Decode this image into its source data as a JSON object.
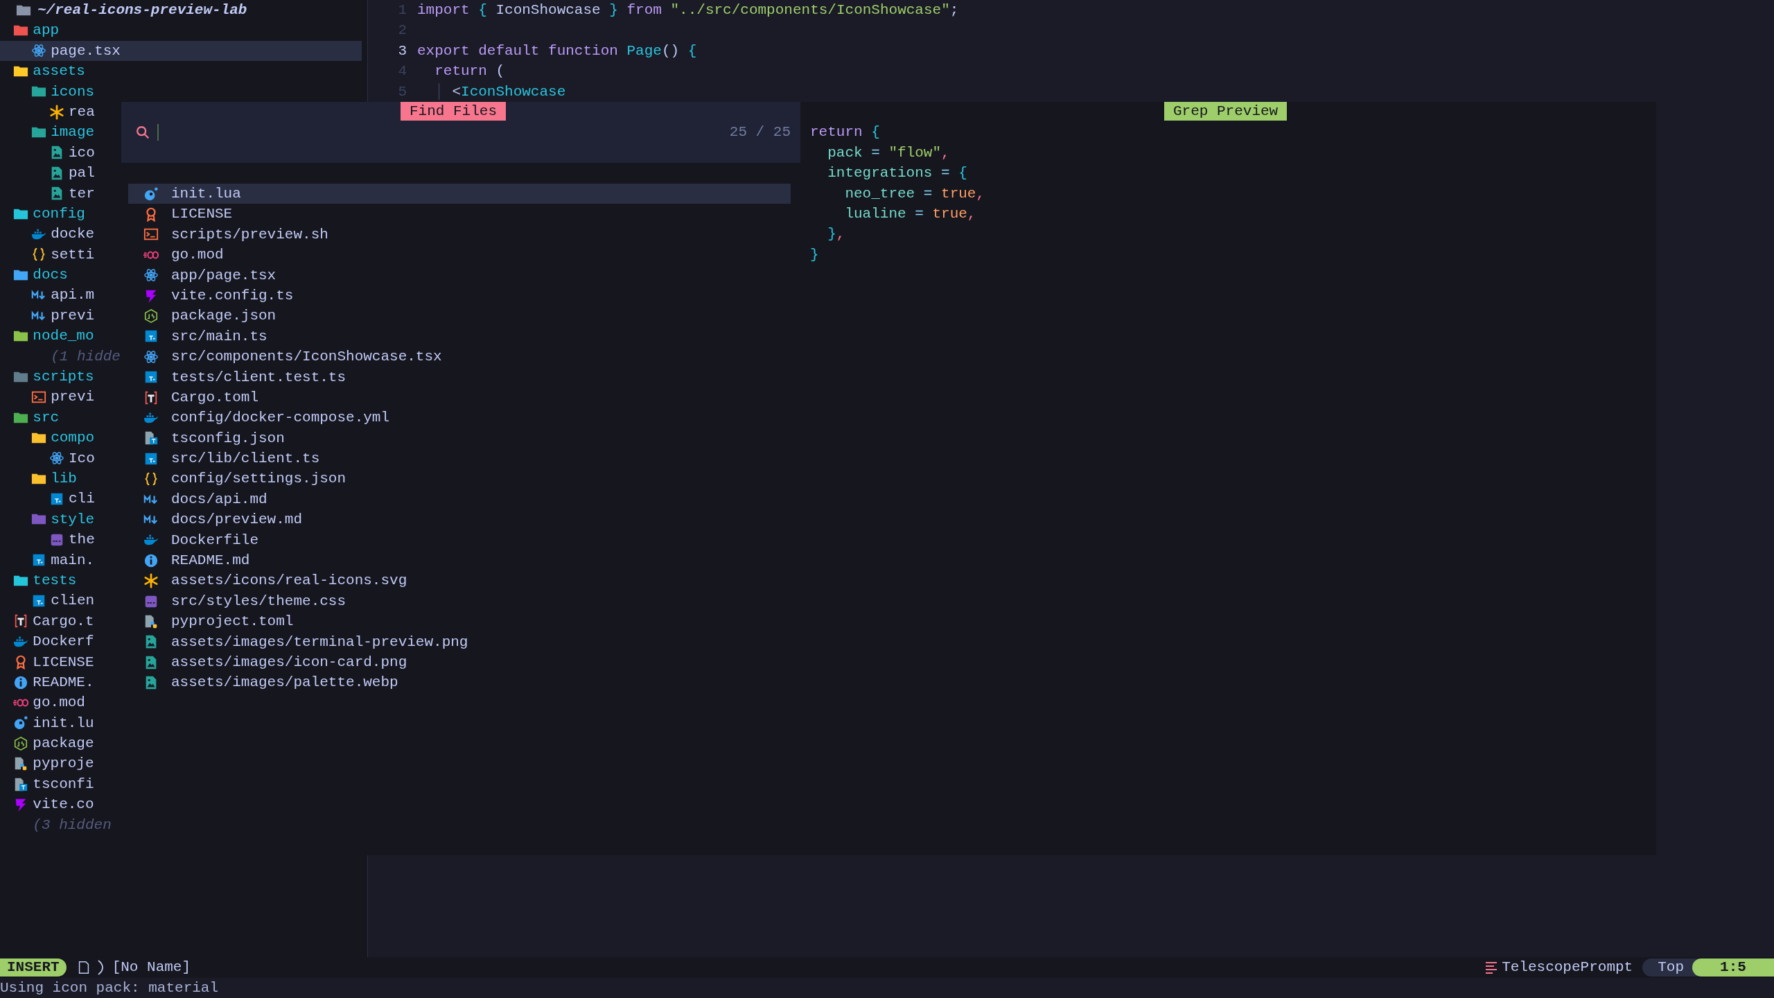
{
  "explorer": {
    "root": "~/real-icons-preview-lab",
    "items": [
      {
        "name": "app",
        "kind": "folder",
        "color": "#ef5350",
        "selected": false,
        "children": [
          {
            "name": "page.tsx",
            "kind": "react",
            "selected": true
          }
        ]
      },
      {
        "name": "assets",
        "kind": "folder",
        "color": "#ffca28",
        "selected": false,
        "children": [
          {
            "name": "icons",
            "kind": "folder",
            "color": "#26a69a",
            "selected": false,
            "children": [
              {
                "name": "rea",
                "kind": "svg",
                "selected": false
              }
            ]
          },
          {
            "name": "image",
            "kind": "folder",
            "color": "#26a69a",
            "selected": false,
            "children": [
              {
                "name": "ico",
                "kind": "image",
                "selected": false
              },
              {
                "name": "pal",
                "kind": "image",
                "selected": false
              },
              {
                "name": "ter",
                "kind": "image",
                "selected": false
              }
            ]
          }
        ]
      },
      {
        "name": "config",
        "kind": "folder",
        "color": "#26c6da",
        "selected": false,
        "children": [
          {
            "name": "docke",
            "kind": "docker",
            "selected": false
          },
          {
            "name": "setti",
            "kind": "json",
            "selected": false
          }
        ]
      },
      {
        "name": "docs",
        "kind": "folder",
        "color": "#42a5f5",
        "selected": false,
        "children": [
          {
            "name": "api.m",
            "kind": "markdown",
            "selected": false
          },
          {
            "name": "previ",
            "kind": "markdown",
            "selected": false
          }
        ]
      },
      {
        "name": "node_mo",
        "kind": "folder",
        "color": "#8bc34a",
        "selected": false,
        "children": [
          {
            "name": "(1 hidde",
            "kind": "hidden",
            "selected": false
          }
        ]
      },
      {
        "name": "scripts",
        "kind": "folder",
        "color": "#607d8b",
        "selected": false,
        "children": [
          {
            "name": "previ",
            "kind": "terminal",
            "selected": false
          }
        ]
      },
      {
        "name": "src",
        "kind": "folder",
        "color": "#4caf50",
        "selected": false,
        "children": [
          {
            "name": "compo",
            "kind": "folder",
            "color": "#fbc02d",
            "selected": false,
            "children": [
              {
                "name": "Ico",
                "kind": "react",
                "selected": false
              }
            ]
          },
          {
            "name": "lib",
            "kind": "folder",
            "color": "#fbc02d",
            "selected": false,
            "children": [
              {
                "name": "cli",
                "kind": "ts",
                "selected": false
              }
            ]
          },
          {
            "name": "style",
            "kind": "folder",
            "color": "#7e57c2",
            "selected": false,
            "children": [
              {
                "name": "the",
                "kind": "css",
                "selected": false
              }
            ]
          },
          {
            "name": "main.",
            "kind": "ts",
            "selected": false
          }
        ]
      },
      {
        "name": "tests",
        "kind": "folder",
        "color": "#26c6da",
        "selected": false,
        "children": [
          {
            "name": "clien",
            "kind": "ts",
            "selected": false
          }
        ]
      },
      {
        "name": "Cargo.t",
        "kind": "toml",
        "selected": false
      },
      {
        "name": "Dockerf",
        "kind": "docker",
        "selected": false
      },
      {
        "name": "LICENSE",
        "kind": "license",
        "selected": false
      },
      {
        "name": "README.",
        "kind": "info",
        "selected": false
      },
      {
        "name": "go.mod",
        "kind": "go",
        "selected": false
      },
      {
        "name": "init.lu",
        "kind": "lua",
        "selected": false
      },
      {
        "name": "package",
        "kind": "node",
        "selected": false
      },
      {
        "name": "pyproje",
        "kind": "python",
        "selected": false
      },
      {
        "name": "tsconfi",
        "kind": "tsconfig",
        "selected": false
      },
      {
        "name": "vite.co",
        "kind": "vite",
        "selected": false
      },
      {
        "name": "(3 hidden",
        "kind": "hidden",
        "selected": false
      }
    ]
  },
  "editor": {
    "lines": [
      {
        "number": "1",
        "current": false,
        "tokens": [
          {
            "text": "import ",
            "kind": "kw"
          },
          {
            "text": "{",
            "kind": "brace"
          },
          {
            "text": " IconShowcase ",
            "kind": "plain"
          },
          {
            "text": "}",
            "kind": "brace"
          },
          {
            "text": " from ",
            "kind": "kw"
          },
          {
            "text": "\"../src/components/IconShowcase\"",
            "kind": "str"
          },
          {
            "text": ";",
            "kind": "plain"
          }
        ]
      },
      {
        "number": "2",
        "current": false
      },
      {
        "number": "3",
        "current": true,
        "tokens": [
          {
            "text": "export default function ",
            "kind": "kw"
          },
          {
            "text": "Page",
            "kind": "func"
          },
          {
            "text": "() ",
            "kind": "plain"
          },
          {
            "text": "{",
            "kind": "brace"
          }
        ]
      },
      {
        "number": "4",
        "current": false,
        "tokens": [
          {
            "text": "  return",
            "kind": "kw"
          },
          {
            "text": " (",
            "kind": "plain"
          }
        ]
      },
      {
        "number": "5",
        "current": false,
        "tokens": [
          {
            "text": "  │",
            "kind": "guide"
          },
          {
            "text": " <",
            "kind": "plain"
          },
          {
            "text": "IconShowcase",
            "kind": "func"
          }
        ]
      }
    ]
  },
  "picker": {
    "title": "Find Files",
    "counter": "25 / 25",
    "results": [
      {
        "path": "init.lua",
        "kind": "lua",
        "selected": true
      },
      {
        "path": "LICENSE",
        "kind": "license",
        "selected": false
      },
      {
        "path": "scripts/preview.sh",
        "kind": "terminal",
        "selected": false
      },
      {
        "path": "go.mod",
        "kind": "go",
        "selected": false
      },
      {
        "path": "app/page.tsx",
        "kind": "react",
        "selected": false
      },
      {
        "path": "vite.config.ts",
        "kind": "vite",
        "selected": false
      },
      {
        "path": "package.json",
        "kind": "node",
        "selected": false
      },
      {
        "path": "src/main.ts",
        "kind": "ts",
        "selected": false
      },
      {
        "path": "src/components/IconShowcase.tsx",
        "kind": "react",
        "selected": false
      },
      {
        "path": "tests/client.test.ts",
        "kind": "ts",
        "selected": false
      },
      {
        "path": "Cargo.toml",
        "kind": "toml",
        "selected": false
      },
      {
        "path": "config/docker-compose.yml",
        "kind": "docker",
        "selected": false
      },
      {
        "path": "tsconfig.json",
        "kind": "tsconfig",
        "selected": false
      },
      {
        "path": "src/lib/client.ts",
        "kind": "ts",
        "selected": false
      },
      {
        "path": "config/settings.json",
        "kind": "json",
        "selected": false
      },
      {
        "path": "docs/api.md",
        "kind": "markdown",
        "selected": false
      },
      {
        "path": "docs/preview.md",
        "kind": "markdown",
        "selected": false
      },
      {
        "path": "Dockerfile",
        "kind": "docker",
        "selected": false
      },
      {
        "path": "README.md",
        "kind": "info",
        "selected": false
      },
      {
        "path": "assets/icons/real-icons.svg",
        "kind": "svg",
        "selected": false
      },
      {
        "path": "src/styles/theme.css",
        "kind": "css",
        "selected": false
      },
      {
        "path": "pyproject.toml",
        "kind": "python",
        "selected": false
      },
      {
        "path": "assets/images/terminal-preview.png",
        "kind": "image",
        "selected": false
      },
      {
        "path": "assets/images/icon-card.png",
        "kind": "image",
        "selected": false
      },
      {
        "path": "assets/images/palette.webp",
        "kind": "image",
        "selected": false
      }
    ]
  },
  "preview": {
    "title": "Grep Preview",
    "lines": [
      [
        {
          "text": "return ",
          "kind": "kw"
        },
        {
          "text": "{",
          "kind": "brace"
        }
      ],
      [
        {
          "text": "  pack",
          "kind": "prop"
        },
        {
          "text": " = ",
          "kind": "op"
        },
        {
          "text": "\"flow\"",
          "kind": "str"
        },
        {
          "text": ",",
          "kind": "punct"
        }
      ],
      [
        {
          "text": "  integrations",
          "kind": "prop"
        },
        {
          "text": " = ",
          "kind": "op"
        },
        {
          "text": "{",
          "kind": "brace"
        }
      ],
      [
        {
          "text": "    neo_tree",
          "kind": "prop"
        },
        {
          "text": " = ",
          "kind": "op"
        },
        {
          "text": "true",
          "kind": "bool"
        },
        {
          "text": ",",
          "kind": "punct"
        }
      ],
      [
        {
          "text": "    lualine",
          "kind": "prop"
        },
        {
          "text": " = ",
          "kind": "op"
        },
        {
          "text": "true",
          "kind": "bool"
        },
        {
          "text": ",",
          "kind": "punct"
        }
      ],
      [
        {
          "text": "  }",
          "kind": "brace"
        },
        {
          "text": ",",
          "kind": "punct"
        }
      ],
      [
        {
          "text": "}",
          "kind": "brace"
        }
      ]
    ]
  },
  "status_bar": {
    "mode": "INSERT",
    "file": "[No Name]",
    "filetype": "TelescopePrompt",
    "position": "Top",
    "cursor": "1:5"
  },
  "message": "Using icon pack: material"
}
